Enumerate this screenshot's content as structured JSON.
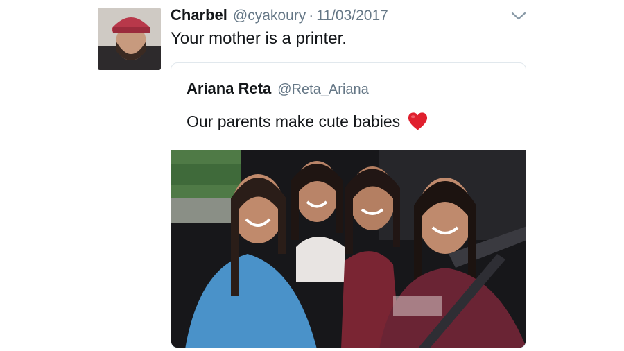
{
  "tweet": {
    "display_name": "Charbel",
    "handle": "@cyakoury",
    "separator": "·",
    "date": "11/03/2017",
    "text": "Your mother is a printer."
  },
  "quoted_tweet": {
    "display_name": "Ariana Reta",
    "handle": "@Reta_Ariana",
    "text": "Our parents make cute babies"
  },
  "icons": {
    "menu": "chevron-down-icon",
    "emoji": "red-heart-icon"
  },
  "colors": {
    "text_primary": "#14171a",
    "text_secondary": "#657786",
    "border": "#e1e8ed",
    "heart": "#e0202e"
  }
}
